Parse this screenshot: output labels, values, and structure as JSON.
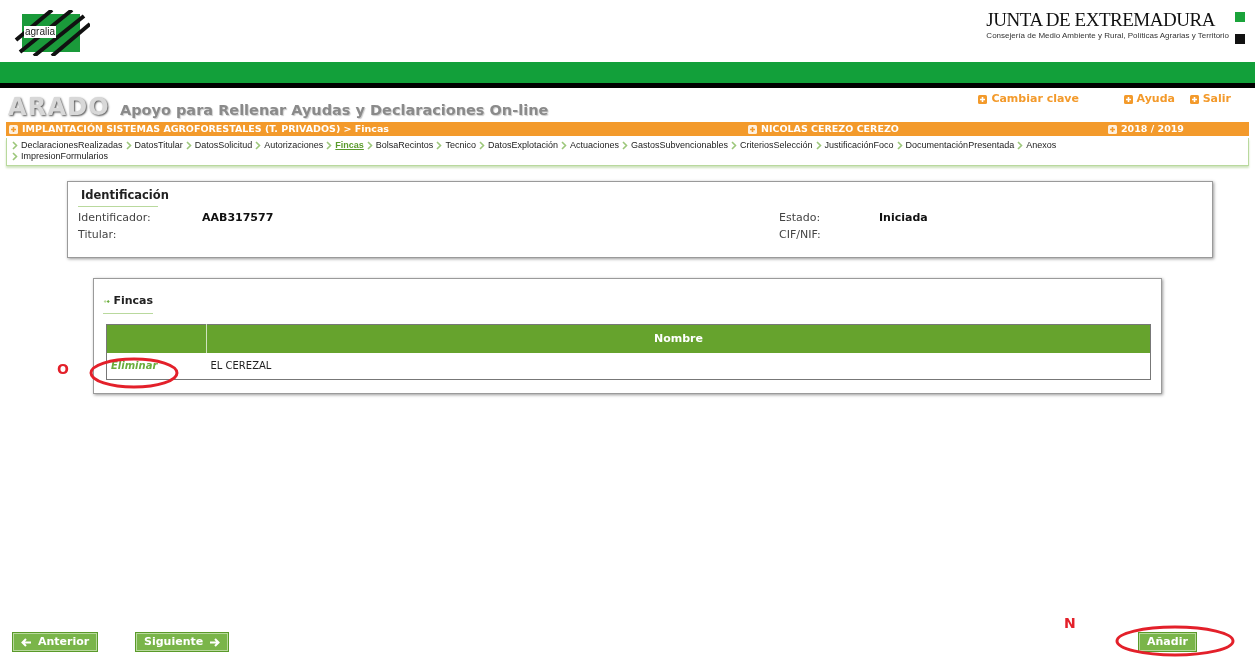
{
  "header": {
    "logo_text": "agralia",
    "org_name": "JUNTA DE EXTREMADURA",
    "org_subtitle": "Consejería de Medio Ambiente y Rural, Políticas Agrarias y Territorio"
  },
  "app": {
    "name": "ARADO",
    "subtitle": "Apoyo para Rellenar Ayudas y Declaraciones On-line",
    "links": [
      "Cambiar clave",
      "Ayuda",
      "Salir"
    ]
  },
  "context_bar": {
    "procedure": "IMPLANTACIÓN SISTEMAS AGROFORESTALES (T. PRIVADOS) > Fincas",
    "user": "NICOLAS CEREZO CEREZO",
    "campaign": "2018 / 2019"
  },
  "steps": [
    {
      "label": "DeclaracionesRealizadas",
      "selected": false
    },
    {
      "label": "DatosTitular",
      "selected": false
    },
    {
      "label": "DatosSolicitud",
      "selected": false
    },
    {
      "label": "Autorizaciones",
      "selected": false
    },
    {
      "label": "Fincas",
      "selected": true
    },
    {
      "label": "BolsaRecintos",
      "selected": false
    },
    {
      "label": "Tecnico",
      "selected": false
    },
    {
      "label": "DatosExplotación",
      "selected": false
    },
    {
      "label": "Actuaciones",
      "selected": false
    },
    {
      "label": "GastosSubvencionables",
      "selected": false
    },
    {
      "label": "CriteriosSelección",
      "selected": false
    },
    {
      "label": "JustificaciónFoco",
      "selected": false
    },
    {
      "label": "DocumentaciónPresentada",
      "selected": false
    },
    {
      "label": "Anexos",
      "selected": false
    },
    {
      "label": "ImpresionFormularios",
      "selected": false
    }
  ],
  "identification": {
    "title": "Identificación",
    "fields": [
      {
        "label": "Identificador:",
        "value": "AAB317577"
      },
      {
        "label": "Estado:",
        "value": "Iniciada"
      },
      {
        "label": "Titular:"
      },
      {
        "label": "CIF/NIF:"
      }
    ]
  },
  "fincas": {
    "title": "Fincas",
    "columns": [
      "Nombre"
    ],
    "rows": [
      {
        "action": "Eliminar",
        "name": "EL CEREZAL"
      }
    ]
  },
  "buttons": {
    "previous": "Anterior",
    "next": "Siguiente",
    "add": "Añadir"
  },
  "annotations": [
    "O",
    "N"
  ]
}
